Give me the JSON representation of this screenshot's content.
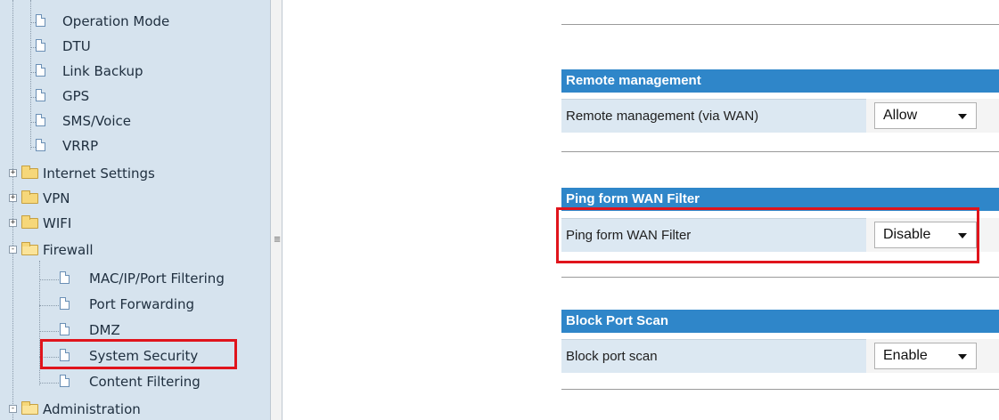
{
  "sidebar": {
    "items": [
      {
        "label": "Operation Mode",
        "type": "doc"
      },
      {
        "label": "DTU",
        "type": "doc"
      },
      {
        "label": "Link Backup",
        "type": "doc"
      },
      {
        "label": "GPS",
        "type": "doc"
      },
      {
        "label": "SMS/Voice",
        "type": "doc"
      },
      {
        "label": "VRRP",
        "type": "doc"
      },
      {
        "label": "Internet Settings",
        "type": "folder",
        "expanded": false
      },
      {
        "label": "VPN",
        "type": "folder",
        "expanded": false
      },
      {
        "label": "WIFI",
        "type": "folder",
        "expanded": false
      },
      {
        "label": "Firewall",
        "type": "folder",
        "expanded": true
      },
      {
        "label": "MAC/IP/Port Filtering",
        "type": "doc"
      },
      {
        "label": "Port Forwarding",
        "type": "doc"
      },
      {
        "label": "DMZ",
        "type": "doc"
      },
      {
        "label": "System Security",
        "type": "doc",
        "selected": true
      },
      {
        "label": "Content Filtering",
        "type": "doc"
      },
      {
        "label": "Administration",
        "type": "folder",
        "expanded": true
      }
    ]
  },
  "main": {
    "sections": [
      {
        "title": "Remote management",
        "row_label": "Remote management (via WAN)",
        "value": "Allow"
      },
      {
        "title": "Ping form WAN Filter",
        "row_label": "Ping form WAN Filter",
        "value": "Disable"
      },
      {
        "title": "Block Port Scan",
        "row_label": "Block port scan",
        "value": "Enable"
      }
    ]
  },
  "colors": {
    "section_header": "#2f86c9",
    "highlight": "#e0141c",
    "sidebar_bg": "#d6e3ee"
  }
}
